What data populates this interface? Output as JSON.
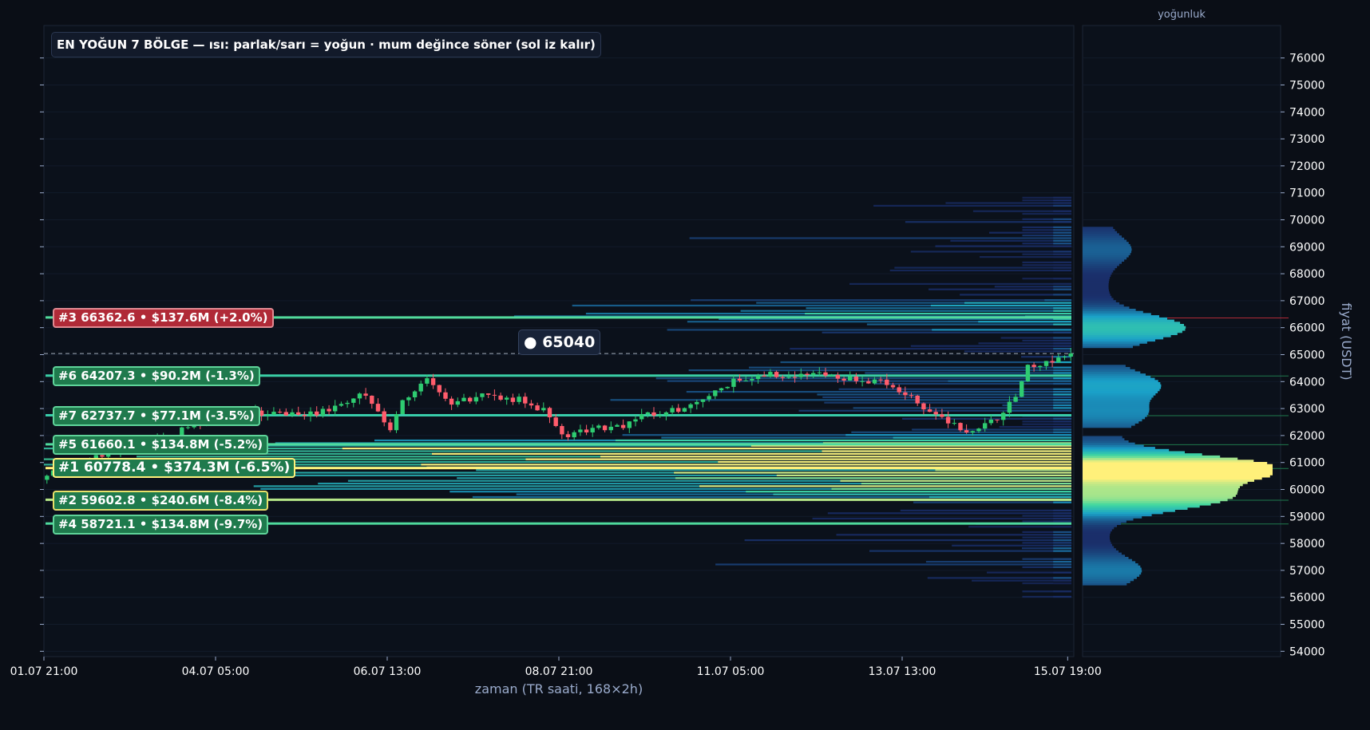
{
  "chart_data": {
    "type": "heatmap",
    "title": "EN YOĞUN 7 BÖLGE — ısı: parlak/sarı = yoğun · mum değince söner (sol iz kalır)",
    "xlabel": "zaman (TR saati, 168×2h)",
    "ylabel": "fiyat (USDT)",
    "side_panel_label": "yoğunluk",
    "ylim": [
      53300,
      76700
    ],
    "yticks": [
      54000,
      55000,
      56000,
      57000,
      58000,
      59000,
      60000,
      61000,
      62000,
      63000,
      64000,
      65000,
      66000,
      67000,
      68000,
      69000,
      70000,
      71000,
      72000,
      73000,
      74000,
      75000,
      76000
    ],
    "xtick_labels": [
      "01.07 21:00",
      "04.07 05:00",
      "06.07 13:00",
      "08.07 21:00",
      "11.07 05:00",
      "13.07 13:00",
      "15.07 19:00"
    ],
    "xtick_index": [
      0,
      28,
      56,
      84,
      112,
      140,
      167
    ],
    "n_candles": 168,
    "current_price": 65040,
    "current_price_label": "● 65040",
    "close_anchors": [
      [
        0,
        60500
      ],
      [
        8,
        61200
      ],
      [
        18,
        61900
      ],
      [
        28,
        62600
      ],
      [
        36,
        62900
      ],
      [
        44,
        62800
      ],
      [
        52,
        63600
      ],
      [
        56,
        62200
      ],
      [
        58,
        63300
      ],
      [
        62,
        64100
      ],
      [
        66,
        63200
      ],
      [
        72,
        63500
      ],
      [
        78,
        63300
      ],
      [
        82,
        62800
      ],
      [
        84,
        62000
      ],
      [
        88,
        62200
      ],
      [
        94,
        62400
      ],
      [
        98,
        62800
      ],
      [
        104,
        63000
      ],
      [
        108,
        63400
      ],
      [
        112,
        64100
      ],
      [
        118,
        64300
      ],
      [
        126,
        64250
      ],
      [
        132,
        64100
      ],
      [
        138,
        63900
      ],
      [
        142,
        63200
      ],
      [
        146,
        62600
      ],
      [
        150,
        62100
      ],
      [
        154,
        62600
      ],
      [
        156,
        62800
      ],
      [
        158,
        63500
      ],
      [
        160,
        64500
      ],
      [
        163,
        64700
      ],
      [
        167,
        65040
      ]
    ],
    "zones": [
      {
        "rank": 3,
        "label": "#3  66362.6  •  $137.6M  (+2.0%)",
        "price": 66362.6,
        "volume_musd": 137.6,
        "pct": 2.0,
        "color": "#b02a37"
      },
      {
        "rank": 6,
        "label": "#6  64207.3  •  $90.2M  (-1.3%)",
        "price": 64207.3,
        "volume_musd": 90.2,
        "pct": -1.3,
        "color": "#1f7a4d"
      },
      {
        "rank": 7,
        "label": "#7  62737.7  •  $77.1M  (-3.5%)",
        "price": 62737.7,
        "volume_musd": 77.1,
        "pct": -3.5,
        "color": "#1f7a4d"
      },
      {
        "rank": 5,
        "label": "#5  61660.1  •  $134.8M  (-5.2%)",
        "price": 61660.1,
        "volume_musd": 134.8,
        "pct": -5.2,
        "color": "#1f7a4d"
      },
      {
        "rank": 1,
        "label": "#1  60778.4  •  $374.3M  (-6.5%)",
        "price": 60778.4,
        "volume_musd": 374.3,
        "pct": -6.5,
        "color": "#1f7a4d"
      },
      {
        "rank": 2,
        "label": "#2  59602.8  •  $240.6M  (-8.4%)",
        "price": 59602.8,
        "volume_musd": 240.6,
        "pct": -8.4,
        "color": "#1f7a4d"
      },
      {
        "rank": 4,
        "label": "#4  58721.1  •  $134.8M  (-9.7%)",
        "price": 58721.1,
        "volume_musd": 134.8,
        "pct": -9.7,
        "color": "#1f7a4d"
      }
    ],
    "density_profile_gaps": [
      [
        64650,
        65300
      ],
      [
        61960,
        62280
      ],
      [
        56100,
        56500
      ]
    ],
    "density_profile_range": [
      56500,
      69700
    ],
    "density_peaks": [
      {
        "price": 60800,
        "intensity": 1.0
      },
      {
        "price": 59700,
        "intensity": 0.68
      },
      {
        "price": 66000,
        "intensity": 0.46
      },
      {
        "price": 63900,
        "intensity": 0.3
      },
      {
        "price": 62800,
        "intensity": 0.22
      },
      {
        "price": 68900,
        "intensity": 0.14
      },
      {
        "price": 57000,
        "intensity": 0.2
      }
    ],
    "colors": {
      "background": "#0a0e16",
      "bull": "#2ecc71",
      "bear": "#ff5c6c",
      "heat_low": "#1a2f6b",
      "heat_mid": "#1aa0c8",
      "heat_high": "#40d8a0",
      "heat_max": "#fff07a",
      "axis_text": "#ffffff",
      "label_text": "#9aabcc"
    }
  }
}
